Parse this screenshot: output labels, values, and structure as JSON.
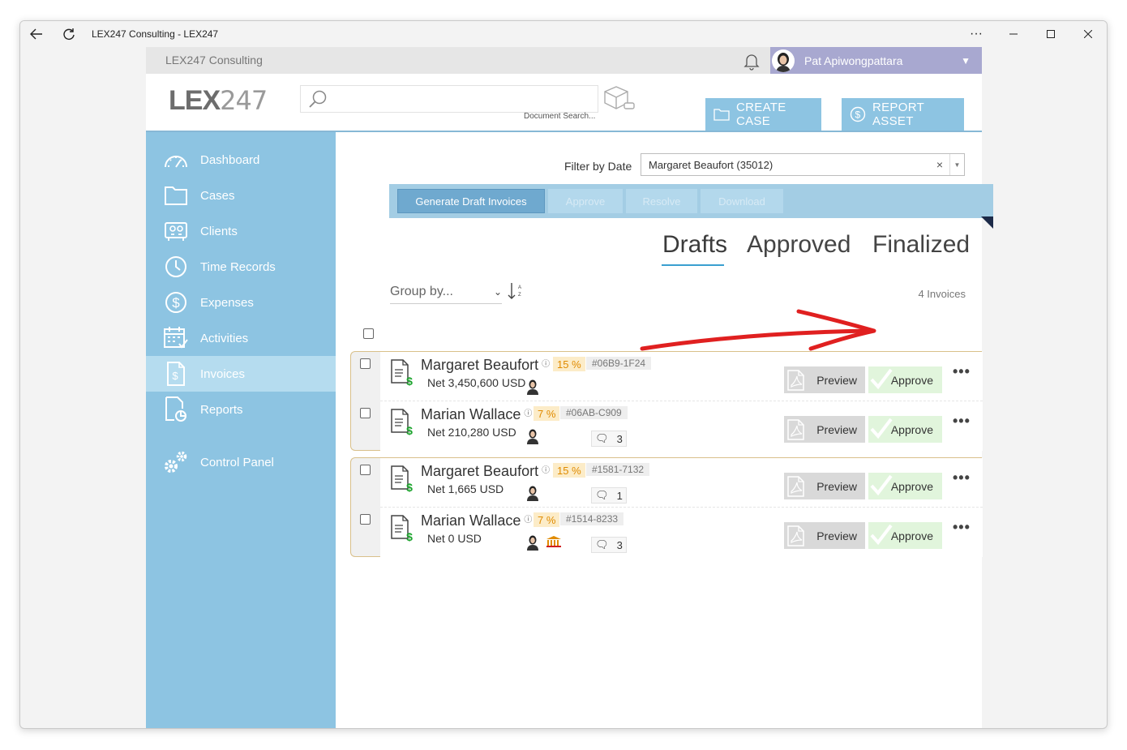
{
  "window": {
    "title": "LEX247 Consulting - LEX247"
  },
  "topbar": {
    "org_name": "LEX247 Consulting",
    "user_name": "Pat Apiwongpattara"
  },
  "header": {
    "logo_bold": "LEX",
    "logo_thin": "247",
    "search_caption": "Document Search...",
    "create_case": "CREATE CASE",
    "report_asset": "REPORT ASSET"
  },
  "sidebar": {
    "items": [
      {
        "label": "Dashboard",
        "icon": "dashboard-icon"
      },
      {
        "label": "Cases",
        "icon": "folder-icon"
      },
      {
        "label": "Clients",
        "icon": "clients-icon"
      },
      {
        "label": "Time Records",
        "icon": "clock-icon"
      },
      {
        "label": "Expenses",
        "icon": "dollar-icon"
      },
      {
        "label": "Activities",
        "icon": "calendar-icon"
      },
      {
        "label": "Invoices",
        "icon": "invoice-icon",
        "active": true
      },
      {
        "label": "Reports",
        "icon": "report-icon"
      },
      {
        "label": "Control Panel",
        "icon": "gears-icon"
      }
    ]
  },
  "filter": {
    "label": "Filter by Date",
    "value": "Margaret Beaufort (35012)",
    "clear": "×",
    "dropdown": "▼"
  },
  "toolbar": {
    "generate": "Generate Draft Invoices",
    "approve": "Approve",
    "resolve": "Resolve",
    "download": "Download"
  },
  "tabs": {
    "drafts": "Drafts",
    "approved": "Approved",
    "finalized": "Finalized"
  },
  "list": {
    "group_by": "Group by...",
    "count": "4 Invoices",
    "preview_label": "Preview",
    "approve_label": "Approve",
    "rows": [
      {
        "name": "Margaret Beaufort",
        "pct": "15 %",
        "code": "#06B9-1F24",
        "net": "Net 3,450,600 USD",
        "comments": ""
      },
      {
        "name": "Marian Wallace",
        "pct": "7 %",
        "code": "#06AB-C909",
        "net": "Net 210,280 USD",
        "comments": "3"
      },
      {
        "name": "Margaret Beaufort",
        "pct": "15 %",
        "code": "#1581-7132",
        "net": "Net 1,665 USD",
        "comments": "1"
      },
      {
        "name": "Marian Wallace",
        "pct": "7 %",
        "code": "#1514-8233",
        "net": "Net 0 USD",
        "comments": "3"
      }
    ]
  },
  "colors": {
    "sidebar": "#8dc4e2",
    "active_nav": "#b5dcef",
    "annotation_arrow": "#e02020"
  }
}
